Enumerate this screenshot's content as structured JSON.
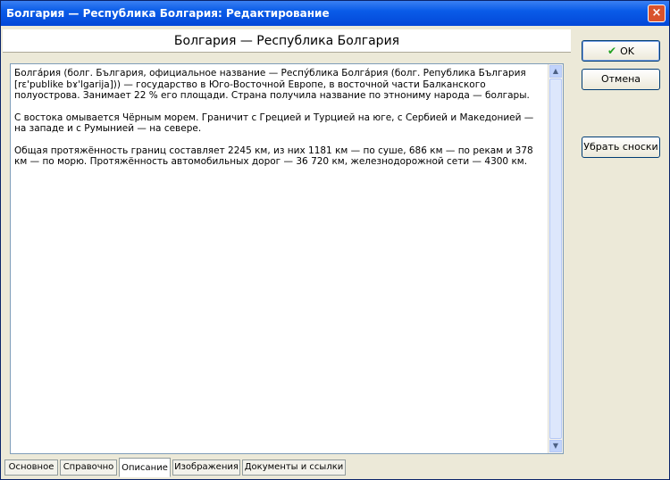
{
  "window": {
    "title": "Болгария — Республика Болгария: Редактирование",
    "close_glyph": "×"
  },
  "header": {
    "title": "Болгария — Республика Болгария"
  },
  "content": {
    "paragraphs": [
      "Болга́рия (болг. България, официальное название — Респу́блика Болга́рия (болг. Република България [rɛ'publike bɤ'lgarija])) — государство в Юго-Восточной Европе, в восточной части Балканского полуострова. Занимает 22 % его площади. Страна получила название по этнониму народа — болгары.",
      "С востока омывается Чёрным морем. Граничит с Грецией и Турцией на юге, с Сербией и Македонией — на западе и с Румынией — на севере.",
      "Общая протяжённость границ составляет 2245 км, из них 1181 км — по суше, 686 км — по рекам и 378 км — по морю. Протяжённость автомобильных дорог — 36 720 км, железнодорожной сети — 4300 км."
    ]
  },
  "buttons": {
    "ok": "OK",
    "cancel": "Отмена",
    "remove_footnotes": "Убрать сноски"
  },
  "tabs": [
    {
      "label": "Основное",
      "active": false
    },
    {
      "label": "Справочно",
      "active": false
    },
    {
      "label": "Описание",
      "active": true
    },
    {
      "label": "Изображения",
      "active": false
    },
    {
      "label": "Документы и ссылки",
      "active": false
    }
  ],
  "icons": {
    "ok": "check-icon",
    "close": "close-icon",
    "scroll_up": "arrow-up-icon",
    "scroll_down": "arrow-down-icon"
  },
  "colors": {
    "titlebar": "#0a5ce8",
    "check": "#21a121",
    "close": "#d9532c"
  }
}
